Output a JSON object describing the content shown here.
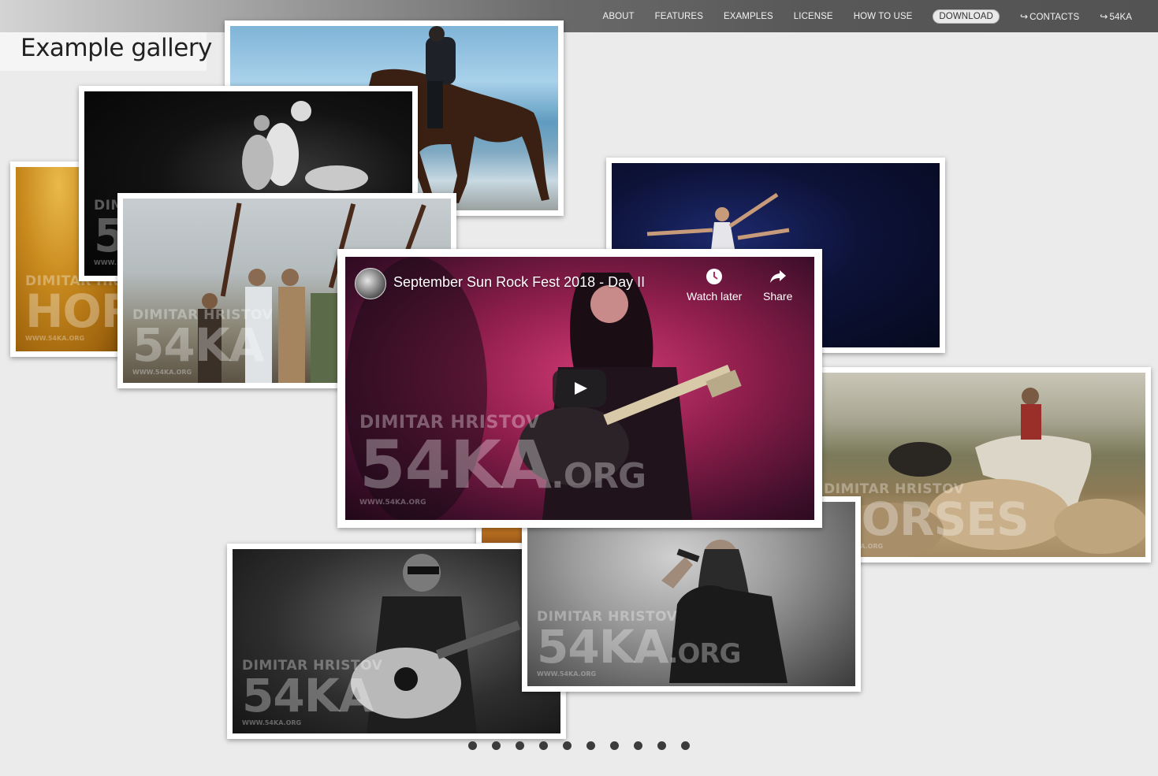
{
  "nav": {
    "items": [
      {
        "label": "ABOUT",
        "arrow": "",
        "highlighted": false
      },
      {
        "label": "FEATURES",
        "arrow": "",
        "highlighted": false
      },
      {
        "label": "EXAMPLES",
        "arrow": "",
        "highlighted": false
      },
      {
        "label": "LICENSE",
        "arrow": "",
        "highlighted": false
      },
      {
        "label": "HOW TO USE",
        "arrow": "",
        "highlighted": false
      },
      {
        "label": "DOWNLOAD",
        "arrow": "",
        "highlighted": true
      },
      {
        "label": "CONTACTS",
        "arrow": "↪",
        "highlighted": false
      },
      {
        "label": "54KA",
        "arrow": "↪",
        "highlighted": false
      }
    ]
  },
  "page": {
    "title": "Example gallery"
  },
  "watermark": {
    "line1": "DIMITAR HRISTOV",
    "line2": "54KA",
    "line2_suffix": ".ORG",
    "line3": "WWW.54KA.ORG",
    "horses_text": "HORSES"
  },
  "video": {
    "title": "September Sun Rock Fest 2018 - Day II",
    "watch_later": "Watch later",
    "share": "Share",
    "watch_later_icon": "clock-icon",
    "share_icon": "share-arrow-icon",
    "play_icon": "play-icon"
  },
  "gallery": {
    "slide_count": 10
  },
  "colors": {
    "background": "#ebebeb",
    "dot": "#3c3c3c",
    "card_border": "#ffffff"
  }
}
